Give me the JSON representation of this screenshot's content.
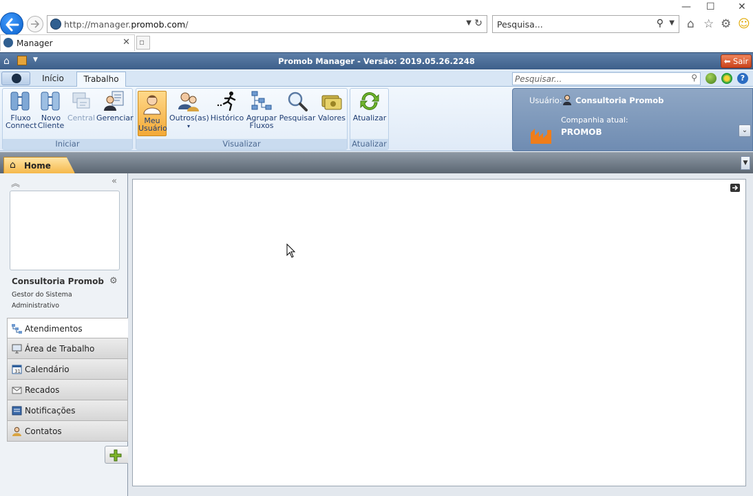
{
  "browser": {
    "url_prefix": "http://manager.",
    "url_domain": "promob.com",
    "url_suffix": "/",
    "search_placeholder": "Pesquisa...",
    "tab_title": "Manager"
  },
  "app": {
    "title": "Promob Manager - Versão: 2019.05.26.2248",
    "exit_label": "Sair"
  },
  "ribbon": {
    "tabs": [
      "Início",
      "Trabalho"
    ],
    "search_placeholder": "Pesquisar...",
    "groups": {
      "iniciar": {
        "label": "Iniciar",
        "buttons": [
          {
            "line1": "Fluxo",
            "line2": "Connect"
          },
          {
            "line1": "Novo",
            "line2": "Cliente"
          },
          {
            "line1": "Central",
            "line2": ""
          },
          {
            "line1": "Gerenciar",
            "line2": ""
          }
        ]
      },
      "visualizar": {
        "label": "Visualizar",
        "buttons": [
          {
            "line1": "Meu",
            "line2": "Usuário"
          },
          {
            "line1": "Outros(as)",
            "line2": ""
          },
          {
            "line1": "Histórico",
            "line2": ""
          },
          {
            "line1": "Agrupar",
            "line2": "Fluxos"
          },
          {
            "line1": "Pesquisar",
            "line2": ""
          },
          {
            "line1": "Valores",
            "line2": ""
          }
        ]
      },
      "atualizar": {
        "label": "Atualizar",
        "buttons": [
          {
            "line1": "Atualizar",
            "line2": ""
          }
        ]
      }
    }
  },
  "user_panel": {
    "user_label": "Usuário:",
    "user_name": "Consultoria Promob",
    "company_label": "Companhia atual:",
    "company_name": "PROMOB"
  },
  "doc_tabs": {
    "home_label": "Home"
  },
  "profile": {
    "name": "Consultoria Promob",
    "role_line1": "Gestor do Sistema",
    "role_line2": "Administrativo"
  },
  "nav": {
    "items": [
      "Atendimentos",
      "Área de Trabalho",
      "Calendário",
      "Recados",
      "Notificações",
      "Contatos"
    ]
  },
  "colors": {
    "accent_orange": "#f5b84b",
    "header_blue": "#3d5f8a",
    "ribbon_text": "#1e3c72"
  }
}
